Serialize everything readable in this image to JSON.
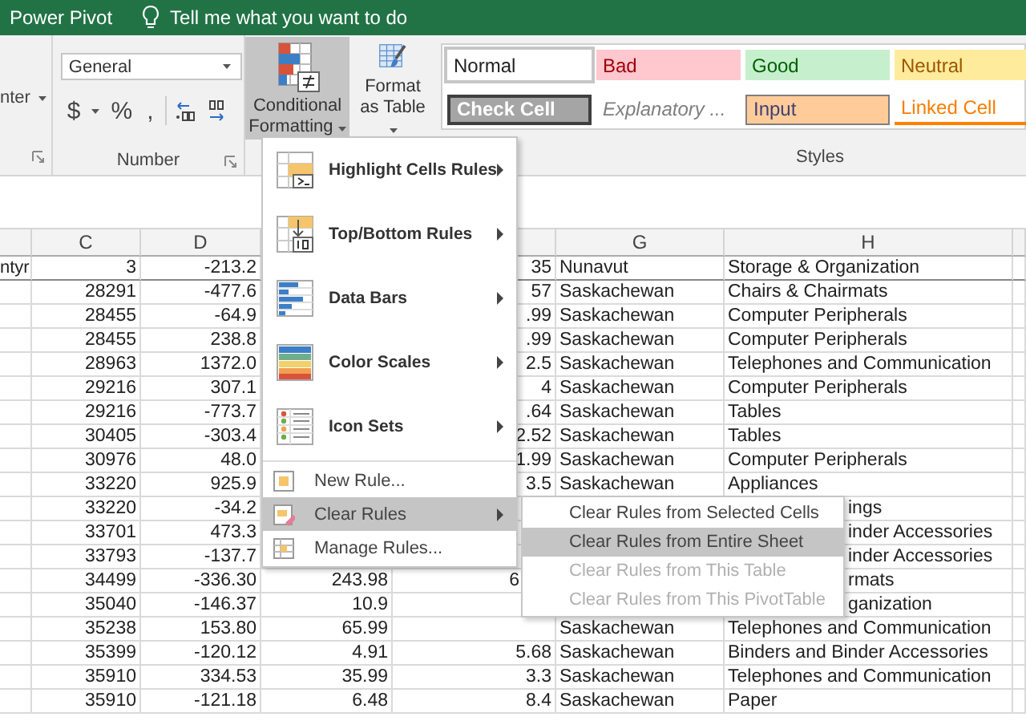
{
  "title_bar": {
    "tab": "Power Pivot",
    "tell_me": "Tell me what you want to do"
  },
  "ribbon": {
    "alignment_group": {
      "button": "nter"
    },
    "number_group": {
      "format_dropdown": "General",
      "buttons": [
        "$",
        "%",
        ","
      ],
      "label": "Number"
    },
    "conditional_formatting": {
      "label": "Conditional Formatting",
      "pressed": true
    },
    "format_as_table": {
      "label": "Format as Table",
      "pressed": false
    },
    "cell_styles": [
      {
        "label": "Normal",
        "kind": "normal",
        "selected": true
      },
      {
        "label": "Bad",
        "kind": "bad",
        "selected": false
      },
      {
        "label": "Good",
        "kind": "good",
        "selected": false
      },
      {
        "label": "Neutral",
        "kind": "neutral",
        "selected": false
      },
      {
        "label": "Check Cell",
        "kind": "check",
        "selected": false
      },
      {
        "label": "Explanatory ...",
        "kind": "explanatory",
        "selected": false
      },
      {
        "label": "Input",
        "kind": "input",
        "selected": false
      },
      {
        "label": "Linked Cell",
        "kind": "linked",
        "selected": false
      }
    ],
    "styles_label": "Styles"
  },
  "columns": [
    null,
    "C",
    "D",
    null,
    null,
    "G",
    "H",
    null
  ],
  "rows": [
    [
      "ntyr",
      "3",
      "-213.2",
      null,
      "35",
      "Nunavut",
      "Storage & Organization",
      null
    ],
    [
      null,
      "28291",
      "-477.6",
      null,
      "57",
      "Saskachewan",
      "Chairs & Chairmats",
      null
    ],
    [
      null,
      "28455",
      "-64.9",
      null,
      ".99",
      "Saskachewan",
      "Computer Peripherals",
      null
    ],
    [
      null,
      "28455",
      "238.8",
      null,
      ".99",
      "Saskachewan",
      "Computer Peripherals",
      null
    ],
    [
      null,
      "28963",
      "1372.0",
      null,
      "2.5",
      "Saskachewan",
      "Telephones and Communication",
      null
    ],
    [
      null,
      "29216",
      "307.1",
      null,
      "4",
      "Saskachewan",
      "Computer Peripherals",
      null
    ],
    [
      null,
      "29216",
      "-773.7",
      null,
      ".64",
      "Saskachewan",
      "Tables",
      null
    ],
    [
      null,
      "30405",
      "-303.4",
      null,
      "2.52",
      "Saskachewan",
      "Tables",
      null
    ],
    [
      null,
      "30976",
      "48.0",
      null,
      "1.99",
      "Saskachewan",
      "Computer Peripherals",
      null
    ],
    [
      null,
      "33220",
      "925.9",
      null,
      "3.5",
      "Saskachewan",
      "Appliances",
      null
    ],
    [
      null,
      "33220",
      "-34.2",
      null,
      null,
      null,
      {
        "text": "ings",
        "clipped": true
      },
      null
    ],
    [
      null,
      "33701",
      "473.3",
      null,
      null,
      null,
      {
        "text": "inder Accessories",
        "clipped": true
      },
      null
    ],
    [
      null,
      "33793",
      "-137.7",
      null,
      null,
      null,
      {
        "text": "inder Accessories",
        "clipped": true
      },
      null
    ],
    [
      null,
      "34499",
      "-336.30",
      "243.98",
      {
        "text": "6",
        "clipped": true
      },
      null,
      {
        "text": "rmats",
        "clipped": true
      },
      null
    ],
    [
      null,
      "35040",
      "-146.37",
      "10.9",
      null,
      null,
      {
        "text": "ganization",
        "clipped": true
      },
      null
    ],
    [
      null,
      "35238",
      "153.80",
      "65.99",
      null,
      "Saskachewan",
      "Telephones and Communication",
      null
    ],
    [
      null,
      "35399",
      "-120.12",
      "4.91",
      "5.68",
      "Saskachewan",
      "Binders and Binder Accessories",
      null
    ],
    [
      null,
      "35910",
      "334.53",
      "35.99",
      "3.3",
      "Saskachewan",
      "Telephones and Communication",
      null
    ],
    [
      null,
      "35910",
      "-121.18",
      "6.48",
      "8.4",
      "Saskachewan",
      "Paper",
      null
    ]
  ],
  "cf_menu": {
    "items": [
      {
        "label": "Highlight Cells Rules",
        "kind": "large",
        "submenu": true,
        "selected": false
      },
      {
        "label": "Top/Bottom Rules",
        "kind": "large",
        "submenu": true,
        "selected": false
      },
      {
        "label": "Data Bars",
        "kind": "large",
        "submenu": true,
        "selected": false
      },
      {
        "label": "Color Scales",
        "kind": "large",
        "submenu": true,
        "selected": false
      },
      {
        "label": "Icon Sets",
        "kind": "large",
        "submenu": true,
        "selected": false
      },
      {
        "label": "New Rule...",
        "kind": "small",
        "submenu": false,
        "selected": false
      },
      {
        "label": "Clear Rules",
        "kind": "small",
        "submenu": true,
        "selected": true
      },
      {
        "label": "Manage Rules...",
        "kind": "small",
        "submenu": false,
        "selected": false
      }
    ]
  },
  "clear_rules_submenu": {
    "items": [
      {
        "label": "Clear Rules from Selected Cells",
        "selected": false,
        "disabled": false
      },
      {
        "label": "Clear Rules from Entire Sheet",
        "selected": true,
        "disabled": false
      },
      {
        "label": "Clear Rules from This Table",
        "selected": false,
        "disabled": true
      },
      {
        "label": "Clear Rules from This PivotTable",
        "selected": false,
        "disabled": true
      }
    ]
  }
}
